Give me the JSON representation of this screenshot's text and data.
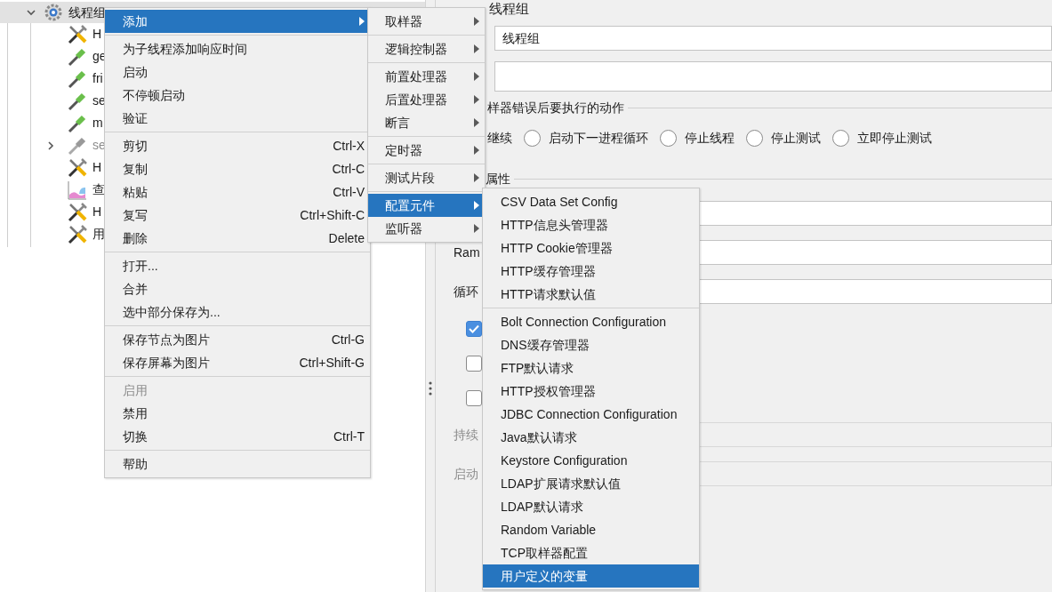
{
  "tree": {
    "label": "线程组",
    "expanded": true,
    "selected": true,
    "children": [
      {
        "label": "H",
        "kind": "tools",
        "disabled": false,
        "expandable": false
      },
      {
        "label": "ge",
        "kind": "dropper",
        "disabled": false,
        "expandable": false
      },
      {
        "label": "fri",
        "kind": "dropper",
        "disabled": false,
        "expandable": false
      },
      {
        "label": "se",
        "kind": "dropper",
        "disabled": false,
        "expandable": false
      },
      {
        "label": "m",
        "kind": "dropper",
        "disabled": false,
        "expandable": false
      },
      {
        "label": "se",
        "kind": "dropper",
        "disabled": true,
        "expandable": true
      },
      {
        "label": "H",
        "kind": "tools",
        "disabled": false,
        "expandable": false
      },
      {
        "label": "查",
        "kind": "chart",
        "disabled": false,
        "expandable": false
      },
      {
        "label": "H",
        "kind": "tools",
        "disabled": false,
        "expandable": false
      },
      {
        "label": "用",
        "kind": "tools",
        "disabled": false,
        "expandable": false
      }
    ]
  },
  "context_menu": {
    "groups": [
      [
        {
          "label": "添加",
          "selected": true,
          "disabled": false,
          "submenu": true
        }
      ],
      [
        {
          "label": "为子线程添加响应时间",
          "selected": false,
          "disabled": false,
          "submenu": false
        },
        {
          "label": "启动",
          "selected": false,
          "disabled": false,
          "submenu": false
        },
        {
          "label": "不停顿启动",
          "selected": false,
          "disabled": false,
          "submenu": false
        },
        {
          "label": "验证",
          "selected": false,
          "disabled": false,
          "submenu": false
        }
      ],
      [
        {
          "label": "剪切",
          "shortcut": "Ctrl-X",
          "selected": false,
          "disabled": false,
          "submenu": false
        },
        {
          "label": "复制",
          "shortcut": "Ctrl-C",
          "selected": false,
          "disabled": false,
          "submenu": false
        },
        {
          "label": "粘贴",
          "shortcut": "Ctrl-V",
          "selected": false,
          "disabled": false,
          "submenu": false
        },
        {
          "label": "复写",
          "shortcut": "Ctrl+Shift-C",
          "selected": false,
          "disabled": false,
          "submenu": false
        },
        {
          "label": "删除",
          "shortcut": "Delete",
          "selected": false,
          "disabled": false,
          "submenu": false
        }
      ],
      [
        {
          "label": "打开...",
          "selected": false,
          "disabled": false,
          "submenu": false
        },
        {
          "label": "合并",
          "selected": false,
          "disabled": false,
          "submenu": false
        },
        {
          "label": "选中部分保存为...",
          "selected": false,
          "disabled": false,
          "submenu": false
        }
      ],
      [
        {
          "label": "保存节点为图片",
          "shortcut": "Ctrl-G",
          "selected": false,
          "disabled": false,
          "submenu": false
        },
        {
          "label": "保存屏幕为图片",
          "shortcut": "Ctrl+Shift-G",
          "selected": false,
          "disabled": false,
          "submenu": false
        }
      ],
      [
        {
          "label": "启用",
          "selected": false,
          "disabled": true,
          "submenu": false
        },
        {
          "label": "禁用",
          "selected": false,
          "disabled": false,
          "submenu": false
        },
        {
          "label": "切换",
          "shortcut": "Ctrl-T",
          "selected": false,
          "disabled": false,
          "submenu": false
        }
      ],
      [
        {
          "label": "帮助",
          "selected": false,
          "disabled": false,
          "submenu": false
        }
      ]
    ]
  },
  "add_menu": {
    "groups": [
      [
        {
          "label": "取样器",
          "selected": false,
          "disabled": false,
          "submenu": true
        }
      ],
      [
        {
          "label": "逻辑控制器",
          "selected": false,
          "disabled": false,
          "submenu": true
        }
      ],
      [
        {
          "label": "前置处理器",
          "selected": false,
          "disabled": false,
          "submenu": true
        },
        {
          "label": "后置处理器",
          "selected": false,
          "disabled": false,
          "submenu": true
        },
        {
          "label": "断言",
          "selected": false,
          "disabled": false,
          "submenu": true
        }
      ],
      [
        {
          "label": "定时器",
          "selected": false,
          "disabled": false,
          "submenu": true
        }
      ],
      [
        {
          "label": "测试片段",
          "selected": false,
          "disabled": false,
          "submenu": true
        }
      ],
      [
        {
          "label": "配置元件",
          "selected": true,
          "disabled": false,
          "submenu": true
        },
        {
          "label": "监听器",
          "selected": false,
          "disabled": false,
          "submenu": true
        }
      ]
    ]
  },
  "config_menu": {
    "groups": [
      [
        {
          "label": "CSV Data Set Config",
          "selected": false,
          "disabled": false,
          "submenu": false
        },
        {
          "label": "HTTP信息头管理器",
          "selected": false,
          "disabled": false,
          "submenu": false
        },
        {
          "label": "HTTP Cookie管理器",
          "selected": false,
          "disabled": false,
          "submenu": false
        },
        {
          "label": "HTTP缓存管理器",
          "selected": false,
          "disabled": false,
          "submenu": false
        },
        {
          "label": "HTTP请求默认值",
          "selected": false,
          "disabled": false,
          "submenu": false
        }
      ],
      [
        {
          "label": "Bolt Connection Configuration",
          "selected": false,
          "disabled": false,
          "submenu": false
        },
        {
          "label": "DNS缓存管理器",
          "selected": false,
          "disabled": false,
          "submenu": false
        },
        {
          "label": "FTP默认请求",
          "selected": false,
          "disabled": false,
          "submenu": false
        },
        {
          "label": "HTTP授权管理器",
          "selected": false,
          "disabled": false,
          "submenu": false
        },
        {
          "label": "JDBC Connection Configuration",
          "selected": false,
          "disabled": false,
          "submenu": false
        },
        {
          "label": "Java默认请求",
          "selected": false,
          "disabled": false,
          "submenu": false
        },
        {
          "label": "Keystore Configuration",
          "selected": false,
          "disabled": false,
          "submenu": false
        },
        {
          "label": "LDAP扩展请求默认值",
          "selected": false,
          "disabled": false,
          "submenu": false
        },
        {
          "label": "LDAP默认请求",
          "selected": false,
          "disabled": false,
          "submenu": false
        },
        {
          "label": "Random Variable",
          "selected": false,
          "disabled": false,
          "submenu": false
        },
        {
          "label": "TCP取样器配置",
          "selected": false,
          "disabled": false,
          "submenu": false
        },
        {
          "label": "用户定义的变量",
          "selected": true,
          "disabled": false,
          "submenu": false
        }
      ]
    ]
  },
  "panel": {
    "title": "线程组",
    "name_value": "线程组",
    "error_action": {
      "legend": "样器错误后要执行的动作",
      "continue_label": "继续",
      "options": [
        {
          "label": "启动下一进程循环",
          "selected": false
        },
        {
          "label": "停止线程",
          "selected": false
        },
        {
          "label": "停止测试",
          "selected": false
        },
        {
          "label": "立即停止测试",
          "selected": false
        }
      ]
    },
    "properties": {
      "legend": "属性",
      "rows": [
        {
          "kind": "field",
          "disabled": false
        },
        {
          "kind": "field",
          "label": "Ram",
          "disabled": false
        },
        {
          "kind": "field",
          "label": "循环",
          "disabled": false
        },
        {
          "kind": "checkbox",
          "checked": true
        },
        {
          "kind": "checkbox",
          "checked": false
        },
        {
          "kind": "checkbox",
          "checked": false
        },
        {
          "kind": "field",
          "label": "持续",
          "disabled": true
        },
        {
          "kind": "field",
          "label": "启动",
          "disabled": true
        }
      ]
    }
  }
}
